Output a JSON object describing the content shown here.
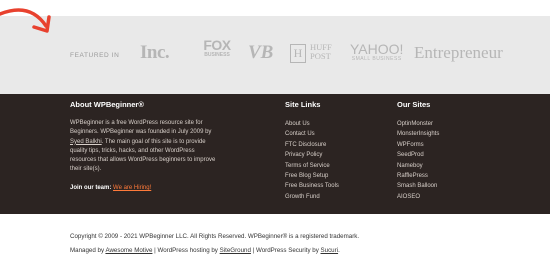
{
  "featured": {
    "label": "FEATURED IN",
    "logos": {
      "inc": "Inc.",
      "fox_main": "FOX",
      "fox_sub": "BUSINESS",
      "vb": "VB",
      "huff_box": "H",
      "huff_line1": "HUFF",
      "huff_line2": "POST",
      "yahoo_main": "YAHOO!",
      "yahoo_sub": "SMALL BUSINESS",
      "entrepreneur": "Entrepreneur"
    }
  },
  "about": {
    "heading": "About WPBeginner®",
    "text_part1": "WPBeginner is a free WordPress resource site for Beginners. WPBeginner was founded in July 2009 by ",
    "founder": "Syed Balkhi",
    "text_part2": ". The main goal of this site is to provide quality tips, tricks, hacks, and other WordPress resources that allows WordPress beginners to improve their site(s).",
    "join_label": "Join our team:",
    "join_link": "We are Hiring!"
  },
  "site_links": {
    "heading": "Site Links",
    "items": [
      "About Us",
      "Contact Us",
      "FTC Disclosure",
      "Privacy Policy",
      "Terms of Service",
      "Free Blog Setup",
      "Free Business Tools",
      "Growth Fund"
    ]
  },
  "our_sites": {
    "heading": "Our Sites",
    "items": [
      "OptinMonster",
      "MonsterInsights",
      "WPForms",
      "SeedProd",
      "Nameboy",
      "RafflePress",
      "Smash Balloon",
      "AIOSEO"
    ]
  },
  "footer": {
    "copyright": "Copyright © 2009 - 2021 WPBeginner LLC. All Rights Reserved. WPBeginner® is a registered trademark.",
    "managed_prefix": "Managed by ",
    "managed_link": "Awesome Motive",
    "hosting_prefix": " | WordPress hosting by ",
    "hosting_link": "SiteGround",
    "security_prefix": " | WordPress Security by ",
    "security_link": "Sucuri",
    "end": "."
  },
  "colors": {
    "featured_bg": "#e9e9e9",
    "dark_bg": "#2c2422",
    "accent_orange": "#ff7a3a",
    "arrow_red": "#e8412e"
  }
}
